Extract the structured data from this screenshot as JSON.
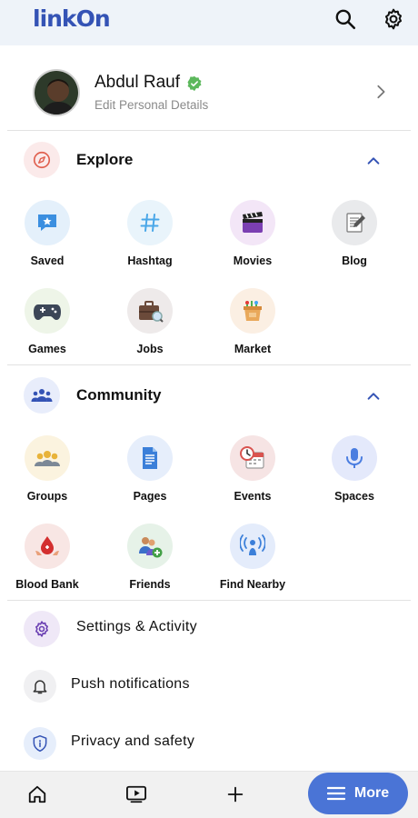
{
  "app": {
    "logo_text": "linkOn"
  },
  "profile": {
    "name": "Abdul Rauf",
    "subtitle": "Edit Personal Details"
  },
  "explore": {
    "title": "Explore",
    "items": [
      {
        "label": "Saved",
        "icon": "saved-icon",
        "bg": "#e4f0fb"
      },
      {
        "label": "Hashtag",
        "icon": "hashtag-icon",
        "bg": "#e9f4fb"
      },
      {
        "label": "Movies",
        "icon": "movies-icon",
        "bg": "#f3e6f7"
      },
      {
        "label": "Blog",
        "icon": "blog-icon",
        "bg": "#e9eaec"
      },
      {
        "label": "Games",
        "icon": "games-icon",
        "bg": "#eef5e8"
      },
      {
        "label": "Jobs",
        "icon": "jobs-icon",
        "bg": "#eeeaea"
      },
      {
        "label": "Market",
        "icon": "market-icon",
        "bg": "#fbefe3"
      }
    ]
  },
  "community": {
    "title": "Community",
    "items": [
      {
        "label": "Groups",
        "icon": "groups-icon",
        "bg": "#fbf3df"
      },
      {
        "label": "Pages",
        "icon": "pages-icon",
        "bg": "#e6eefb"
      },
      {
        "label": "Events",
        "icon": "events-icon",
        "bg": "#f6e4e4"
      },
      {
        "label": "Spaces",
        "icon": "spaces-icon",
        "bg": "#e4e9fb"
      },
      {
        "label": "Blood Bank",
        "icon": "blood-bank-icon",
        "bg": "#f8e6e4"
      },
      {
        "label": "Friends",
        "icon": "friends-icon",
        "bg": "#e6f2e8"
      },
      {
        "label": "Find Nearby",
        "icon": "find-nearby-icon",
        "bg": "#e4ecfb"
      }
    ]
  },
  "menu": {
    "settings": "Settings & Activity",
    "push": "Push notifications",
    "privacy": "Privacy and safety"
  },
  "bottom_nav": {
    "more_label": "More"
  },
  "colors": {
    "accent": "#4a74d6",
    "brand": "#3453b5",
    "verified": "#5cb85c"
  }
}
